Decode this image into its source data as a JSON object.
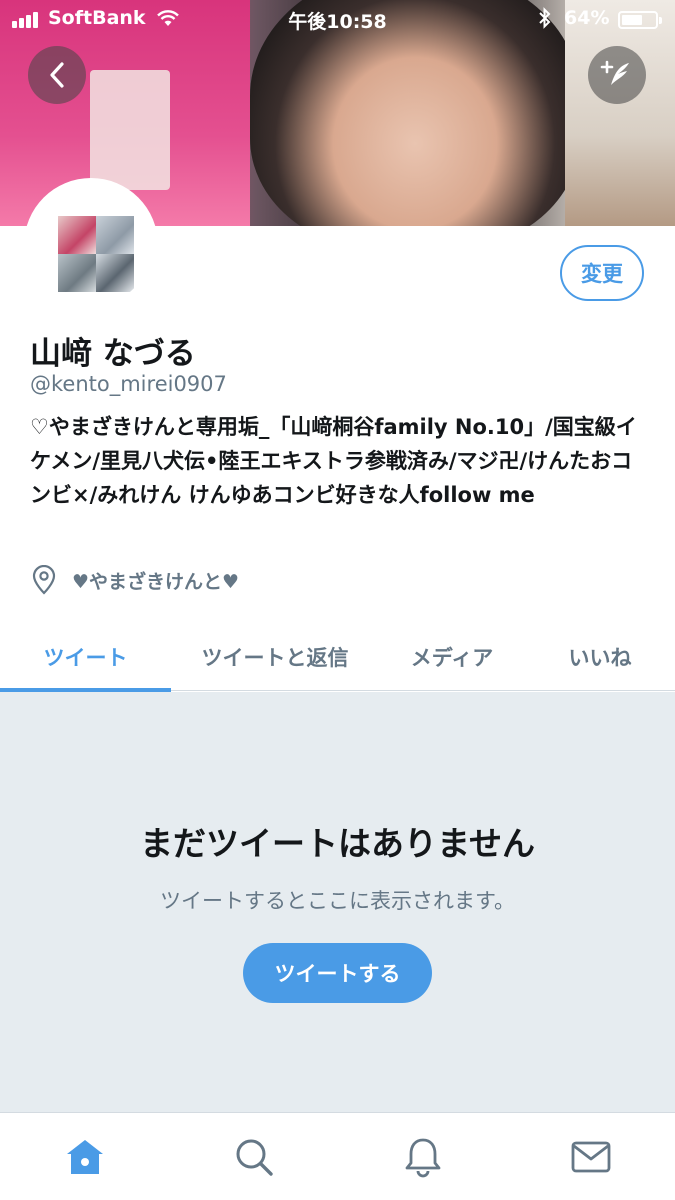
{
  "status_bar": {
    "carrier": "SoftBank",
    "time": "午後10:58",
    "battery_percent": "64%",
    "battery_level": 0.64,
    "icons": [
      "signal-icon",
      "wifi-icon",
      "bluetooth-icon",
      "battery-icon"
    ]
  },
  "header": {
    "back_icon": "chevron-left-icon",
    "compose_icon": "compose-tweet-icon"
  },
  "profile": {
    "edit_label": "変更",
    "display_name": "山﨑 なづる",
    "handle": "@kento_mirei0907",
    "bio": "♡やまざきけんと専用垢_「山﨑桐谷family No.10」/国宝級イケメン/里見八犬伝•陸王エキストラ参戦済み/マジ卍/けんたおコンビ×/みれけん けんゆあコンビ好きな人follow me",
    "location_icon": "location-pin-icon",
    "location": "♥やまざきけんと♥"
  },
  "tabs": [
    {
      "label": "ツイート",
      "active": true
    },
    {
      "label": "ツイートと返信",
      "active": false
    },
    {
      "label": "メディア",
      "active": false
    },
    {
      "label": "いいね",
      "active": false
    }
  ],
  "empty_state": {
    "title": "まだツイートはありません",
    "subtitle": "ツイートするとここに表示されます。",
    "button_label": "ツイートする"
  },
  "bottom_nav": [
    {
      "icon": "home-icon",
      "active": true
    },
    {
      "icon": "search-icon",
      "active": false
    },
    {
      "icon": "notifications-bell-icon",
      "active": false
    },
    {
      "icon": "messages-envelope-icon",
      "active": false
    }
  ],
  "colors": {
    "accent": "#4a9be6",
    "text_primary": "#14171a",
    "text_secondary": "#657786",
    "empty_bg": "#e6ecf0"
  }
}
